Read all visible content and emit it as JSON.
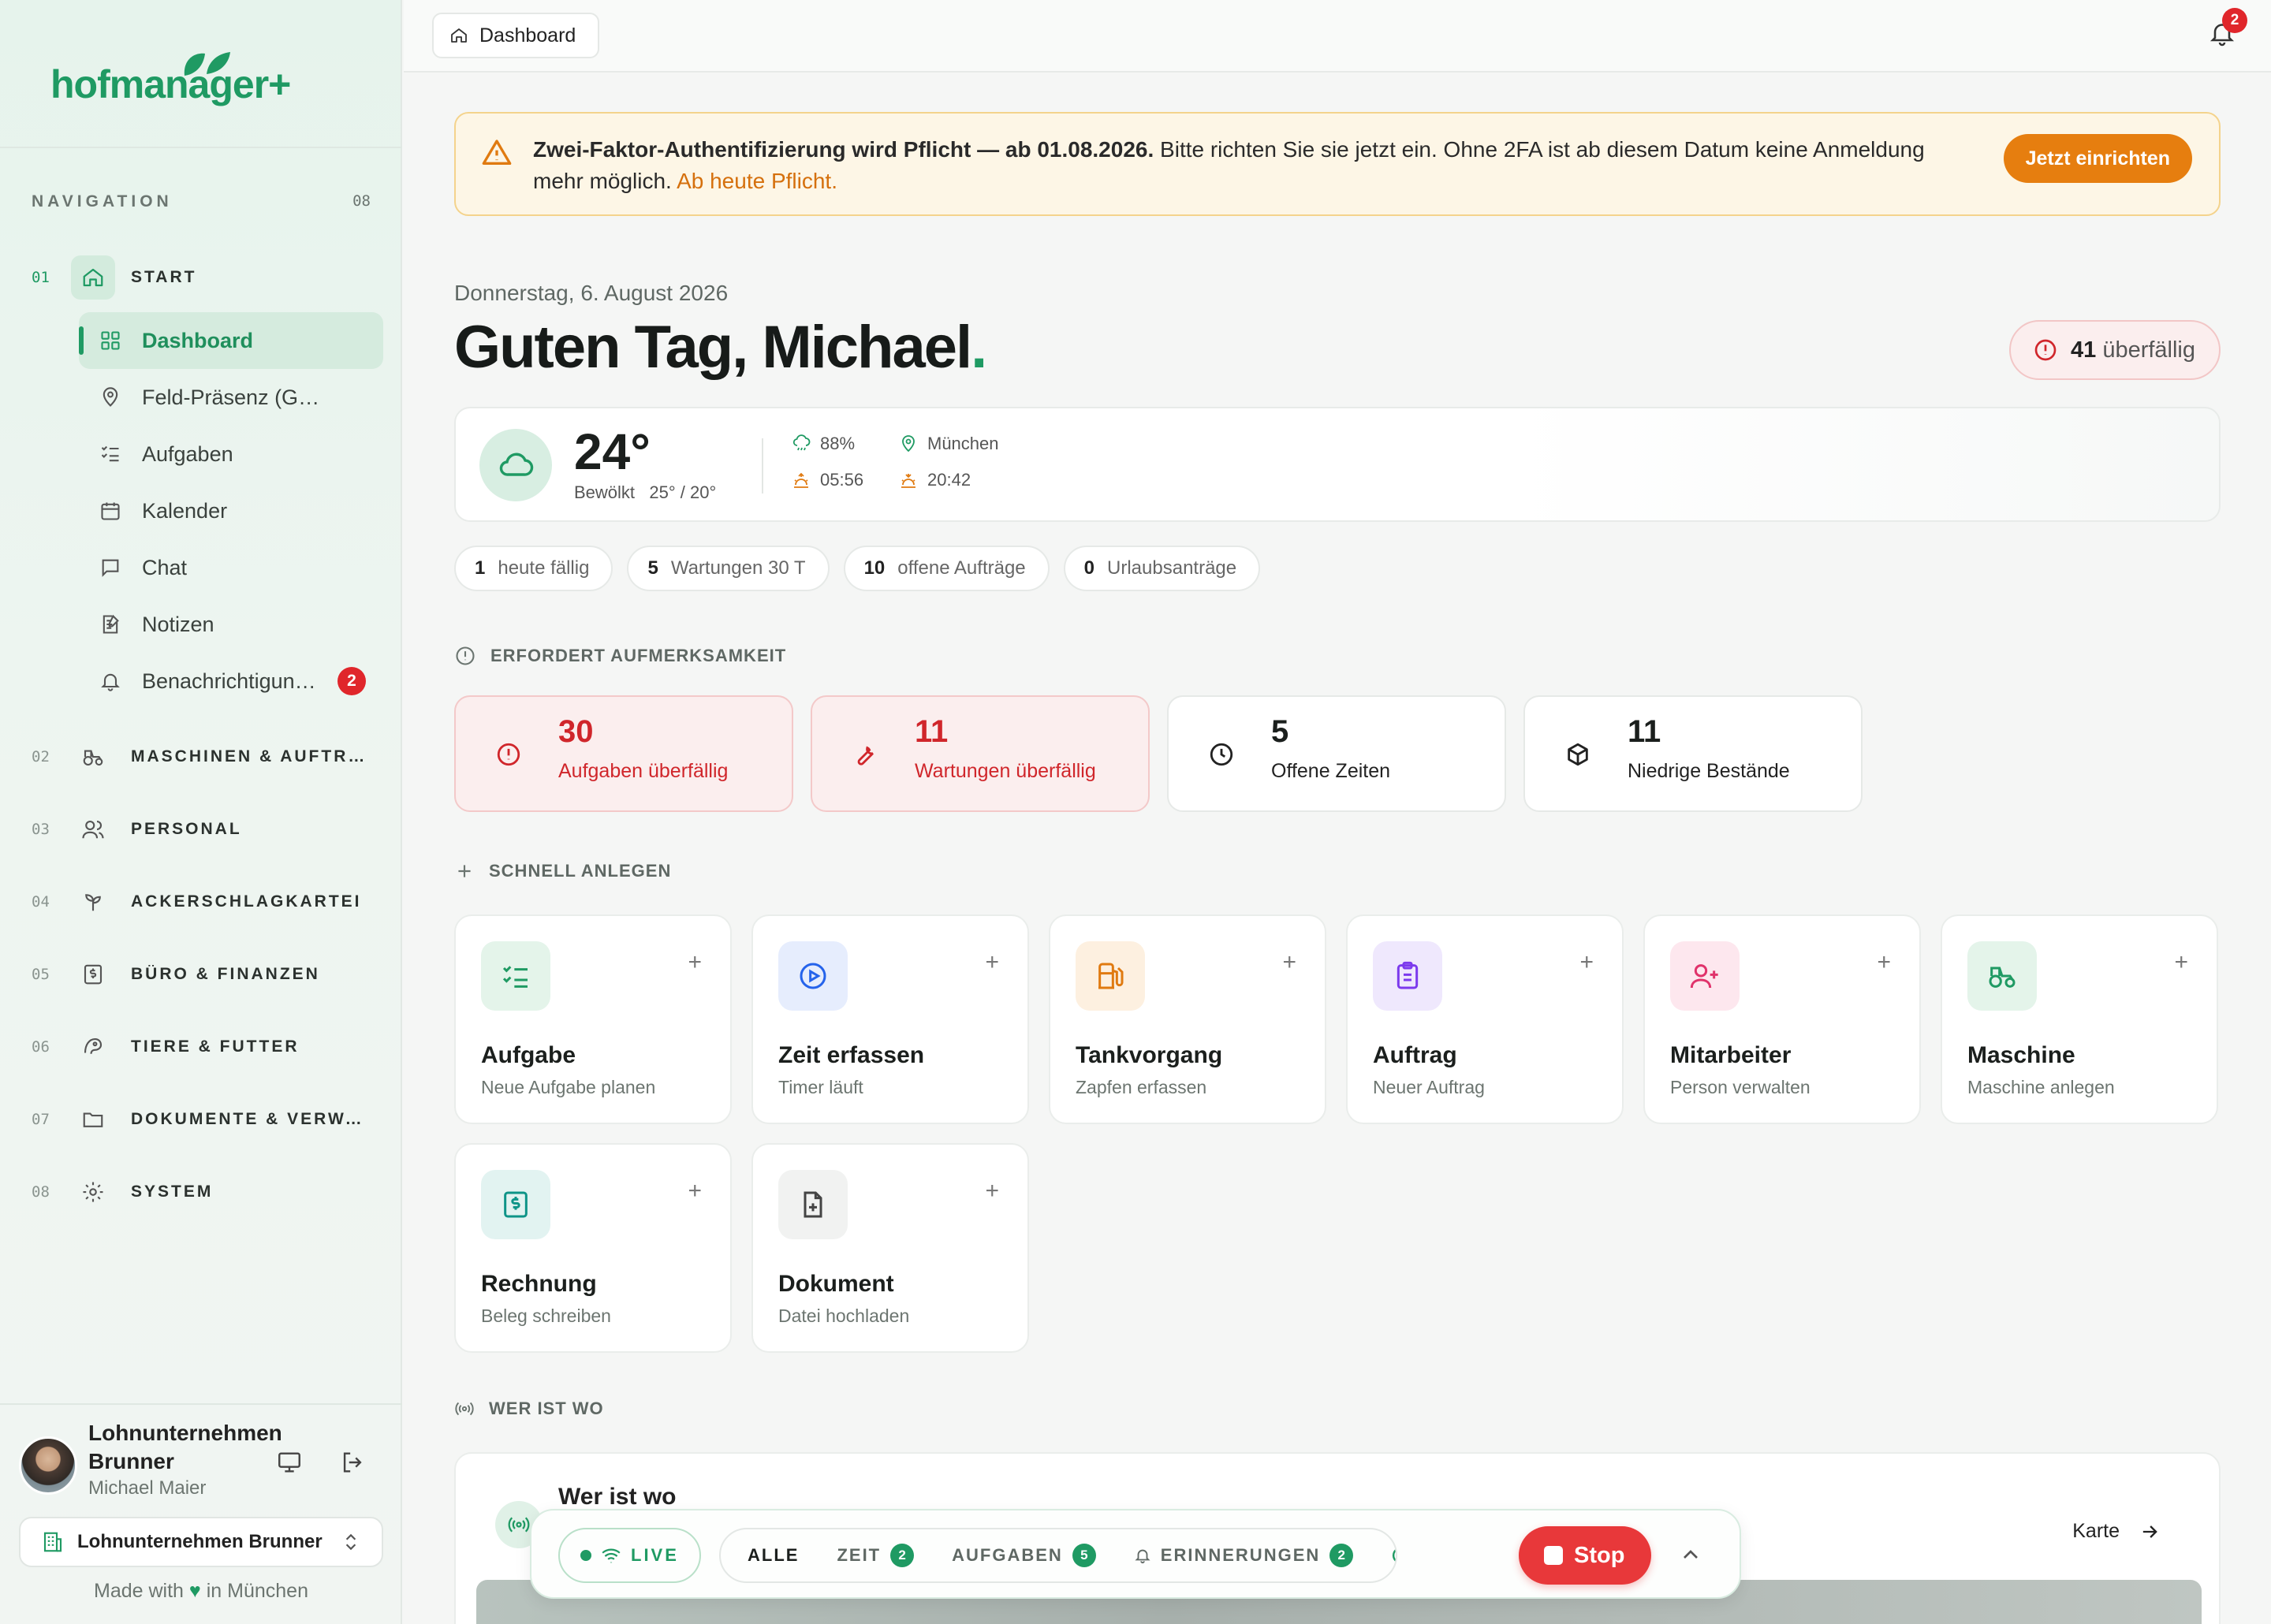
{
  "brand": {
    "name": "hofmanager+",
    "color": "#1f9a63"
  },
  "sidebar": {
    "nav_label": "NAVIGATION",
    "nav_count": "08",
    "sections": [
      {
        "num": "01",
        "label": "START",
        "icon": "home-icon"
      },
      {
        "num": "02",
        "label": "MASCHINEN & AUFTRÄGE",
        "icon": "tractor-icon"
      },
      {
        "num": "03",
        "label": "PERSONAL",
        "icon": "users-icon"
      },
      {
        "num": "04",
        "label": "ACKERSCHLAGKARTEI",
        "icon": "sprout-icon"
      },
      {
        "num": "05",
        "label": "BÜRO & FINANZEN",
        "icon": "receipt-icon"
      },
      {
        "num": "06",
        "label": "TIERE & FUTTER",
        "icon": "animal-icon"
      },
      {
        "num": "07",
        "label": "DOKUMENTE & VERWALTUNG",
        "icon": "folder-icon"
      },
      {
        "num": "08",
        "label": "SYSTEM",
        "icon": "gear-icon"
      }
    ],
    "start_items": [
      {
        "label": "Dashboard",
        "icon": "grid-icon",
        "active": true
      },
      {
        "label": "Feld-Präsenz (GPS)",
        "icon": "map-pin-icon"
      },
      {
        "label": "Aufgaben",
        "icon": "checklist-icon"
      },
      {
        "label": "Kalender",
        "icon": "calendar-icon"
      },
      {
        "label": "Chat",
        "icon": "chat-icon"
      },
      {
        "label": "Notizen",
        "icon": "notes-icon"
      },
      {
        "label": "Benachrichtigungen",
        "icon": "bell-icon",
        "badge": "2"
      }
    ],
    "user": {
      "company_line": "Lohnunternehmen Brunner",
      "name": "Michael Maier"
    },
    "company_select": "Lohnunternehmen Brunner",
    "footer_pre": "Made with",
    "footer_heart": "♥",
    "footer_post": "in München"
  },
  "topbar": {
    "breadcrumb": "Dashboard",
    "notif_count": "2"
  },
  "alert": {
    "bold": "Zwei-Faktor-Authentifizierung wird Pflicht — ab 01.08.2026.",
    "text": " Bitte richten Sie sie jetzt ein. Ohne 2FA ist ab diesem Datum keine Anmeldung mehr möglich.",
    "highlight": "Ab heute Pflicht.",
    "button": "Jetzt einrichten"
  },
  "greeting": {
    "date": "Donnerstag, 6. August 2026",
    "text": "Guten Tag, Michael",
    "dot": "."
  },
  "overdue": {
    "count": "41",
    "label": "überfällig"
  },
  "weather": {
    "temp": "24°",
    "condition": "Bewölkt",
    "range": "25° / 20°",
    "humidity": "88%",
    "location": "München",
    "sunrise": "05:56",
    "sunset": "20:42"
  },
  "chips": [
    {
      "num": "1",
      "label": "heute fällig"
    },
    {
      "num": "5",
      "label": "Wartungen 30 T"
    },
    {
      "num": "10",
      "label": "offene Aufträge"
    },
    {
      "num": "0",
      "label": "Urlaubsanträge"
    }
  ],
  "attention": {
    "title": "ERFORDERT AUFMERKSAMKEIT",
    "cards": [
      {
        "num": "30",
        "label": "Aufgaben überfällig",
        "icon": "alert-circle-icon",
        "tone": "red"
      },
      {
        "num": "11",
        "label": "Wartungen überfällig",
        "icon": "wrench-icon",
        "tone": "red"
      },
      {
        "num": "5",
        "label": "Offene Zeiten",
        "icon": "clock-icon",
        "tone": "neutral"
      },
      {
        "num": "11",
        "label": "Niedrige Bestände",
        "icon": "package-icon",
        "tone": "neutral"
      }
    ]
  },
  "quick": {
    "title": "SCHNELL ANLEGEN",
    "cards": [
      {
        "title": "Aufgabe",
        "sub": "Neue Aufgabe planen",
        "icon": "checklist-icon",
        "color": "#1f9a63",
        "bg": "#e4f4ea"
      },
      {
        "title": "Zeit erfassen",
        "sub": "Timer läuft",
        "icon": "play-circle-icon",
        "color": "#2563eb",
        "bg": "#e6edfd"
      },
      {
        "title": "Tankvorgang",
        "sub": "Zapfen erfassen",
        "icon": "fuel-icon",
        "color": "#e07a10",
        "bg": "#fdf0e0"
      },
      {
        "title": "Auftrag",
        "sub": "Neuer Auftrag",
        "icon": "clipboard-icon",
        "color": "#7c3aed",
        "bg": "#efe8fd"
      },
      {
        "title": "Mitarbeiter",
        "sub": "Person verwalten",
        "icon": "user-plus-icon",
        "color": "#e0336b",
        "bg": "#fde7ee"
      },
      {
        "title": "Maschine",
        "sub": "Maschine anlegen",
        "icon": "tractor-icon",
        "color": "#1f9a63",
        "bg": "#e4f4ea"
      },
      {
        "title": "Rechnung",
        "sub": "Beleg schreiben",
        "icon": "invoice-icon",
        "color": "#0e9488",
        "bg": "#e2f3f1"
      },
      {
        "title": "Dokument",
        "sub": "Datei hochladen",
        "icon": "file-plus-icon",
        "color": "#444",
        "bg": "#f1f2f1"
      }
    ]
  },
  "who": {
    "title": "WER IST WO",
    "card_title": "Wer ist wo",
    "map_link": "Karte"
  },
  "livebar": {
    "live": "LIVE",
    "tabs": [
      {
        "label": "ALLE"
      },
      {
        "label": "ZEIT",
        "count": "2"
      },
      {
        "label": "AUFGABEN",
        "count": "5"
      },
      {
        "label": "ERINNERUNGEN",
        "count": "2"
      }
    ],
    "stop": "Stop"
  }
}
